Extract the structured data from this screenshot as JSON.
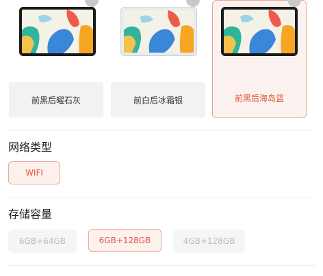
{
  "colors": {
    "accent": "#e0573c",
    "accent_border": "#e8a898",
    "selected_bg": "#fdf1ee",
    "disabled_text": "#b9b9b9"
  },
  "color_options": [
    {
      "label": "前黑后曜石灰",
      "frame": "#1a1a1a",
      "selected": false
    },
    {
      "label": "前白后冰霜银",
      "frame": "#e9ebec",
      "selected": false
    },
    {
      "label": "前黑后海岛蓝",
      "frame": "#1a1a1a",
      "selected": true
    }
  ],
  "network": {
    "title": "网络类型",
    "options": [
      {
        "label": "WIFI",
        "state": "selected"
      }
    ]
  },
  "storage": {
    "title": "存储容量",
    "options": [
      {
        "label": "6GB+64GB",
        "state": "disabled"
      },
      {
        "label": "6GB+128GB",
        "state": "selected"
      },
      {
        "label": "4GB+128GB",
        "state": "disabled"
      }
    ]
  }
}
